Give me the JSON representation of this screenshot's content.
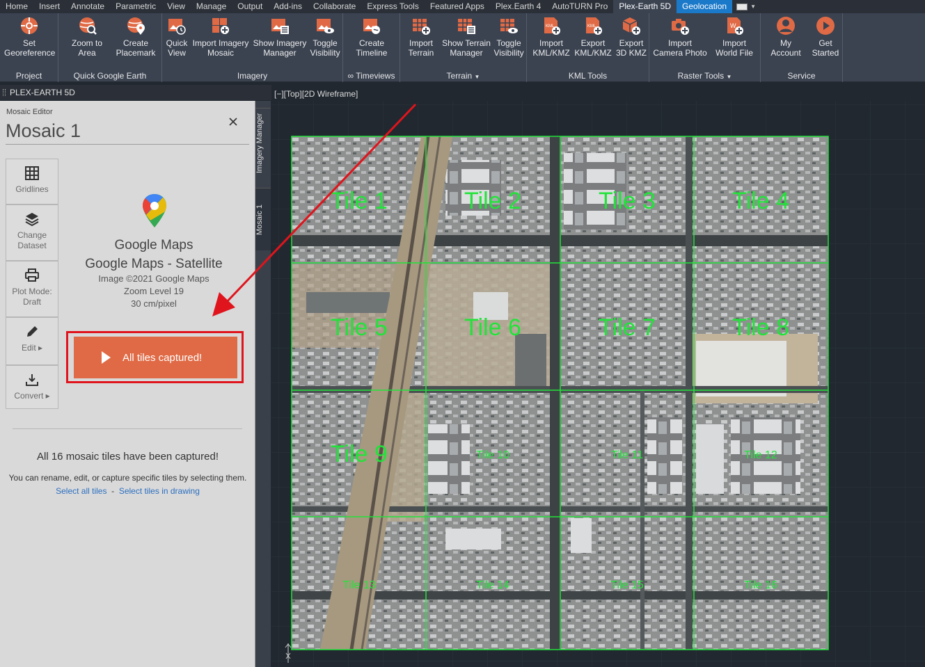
{
  "ribbon": {
    "tabs": [
      "Home",
      "Insert",
      "Annotate",
      "Parametric",
      "View",
      "Manage",
      "Output",
      "Add-ins",
      "Collaborate",
      "Express Tools",
      "Featured Apps",
      "Plex.Earth 4",
      "AutoTURN Pro",
      "Plex-Earth 5D",
      "Geolocation"
    ],
    "active_tab": "Plex-Earth 5D",
    "panels": {
      "project": "Project",
      "quick_google_earth": "Quick Google Earth",
      "imagery": "Imagery",
      "timeviews": "∞ Timeviews",
      "terrain": "Terrain",
      "kml_tools": "KML Tools",
      "raster_tools": "Raster Tools",
      "service": "Service"
    },
    "buttons": {
      "set_georeference": [
        "Set",
        "Georeference"
      ],
      "zoom_to_area": [
        "Zoom to",
        "Area"
      ],
      "create_placemark": [
        "Create",
        "Placemark"
      ],
      "quick_view": [
        "Quick",
        "View"
      ],
      "import_imagery_mosaic": [
        "Import Imagery",
        "Mosaic"
      ],
      "show_imagery_manager": [
        "Show Imagery",
        "Manager"
      ],
      "toggle_visibility_imagery": [
        "Toggle",
        "Visibility"
      ],
      "create_timeline": [
        "Create",
        "Timeline"
      ],
      "import_terrain": [
        "Import",
        "Terrain"
      ],
      "show_terrain_manager": [
        "Show Terrain",
        "Manager"
      ],
      "toggle_visibility_terrain": [
        "Toggle",
        "Visibility"
      ],
      "import_kml": [
        "Import",
        "KML/KMZ"
      ],
      "export_kml": [
        "Export",
        "KML/KMZ"
      ],
      "export_3d_kmz": [
        "Export",
        "3D KMZ"
      ],
      "import_camera_photo": [
        "Import",
        "Camera Photo"
      ],
      "import_world_file": [
        "Import",
        "World File"
      ],
      "my_account": [
        "My",
        "Account"
      ],
      "get_started": [
        "Get",
        "Started"
      ]
    }
  },
  "palette": {
    "title": "PLEX-EARTH 5D",
    "editor_label": "Mosaic Editor",
    "mosaic_name": "Mosaic 1",
    "side_tabs": [
      "Imagery Manager",
      "Mosaic 1"
    ],
    "tools": [
      {
        "label": "Gridlines",
        "icon": "grid-icon"
      },
      {
        "label": "Change Dataset",
        "icon": "layers-icon"
      },
      {
        "label": "Plot Mode: Draft",
        "icon": "printer-icon"
      },
      {
        "label": "Edit ▸",
        "icon": "pencil-icon"
      },
      {
        "label": "Convert ▸",
        "icon": "download-icon"
      }
    ],
    "dataset": {
      "provider": "Google Maps",
      "name": "Google Maps - Satellite",
      "copyright": "Image ©2021 Google Maps",
      "zoom": "Zoom Level 19",
      "resolution": "30 cm/pixel"
    },
    "capture_button": "All tiles captured!",
    "status_message": "All 16 mosaic tiles have been captured!",
    "status_hint": "You can rename, edit, or capture specific tiles by selecting them.",
    "link_select_all": "Select all tiles",
    "link_separator": "-",
    "link_select_drawing": "Select tiles in drawing"
  },
  "viewport": {
    "label": "[−][Top][2D Wireframe]",
    "tiles": [
      "Tile 1",
      "Tile 2",
      "Tile 3",
      "Tile 4",
      "Tile 5",
      "Tile 6",
      "Tile 7",
      "Tile 8",
      "Tile 9",
      "Tile 10",
      "Tile 11",
      "Tile 12",
      "Tile 13",
      "Tile 14",
      "Tile 15",
      "Tile 16"
    ]
  },
  "colors": {
    "accent_orange": "#e06a45",
    "tile_green": "#22e33a",
    "highlight_red": "#e0141c",
    "geolocation_blue": "#1b79c9"
  }
}
